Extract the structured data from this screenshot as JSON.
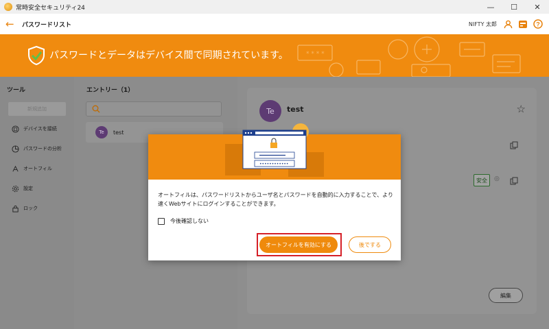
{
  "window": {
    "title": "常時安全セキュリティ24",
    "minimize": "—",
    "maximize": "☐",
    "close": "✕"
  },
  "header": {
    "title": "パスワードリスト",
    "user": "NIFTY 太郎"
  },
  "banner": {
    "text": "パスワードとデータはデバイス間で同期されています。"
  },
  "sidebar": {
    "heading": "ツール",
    "button_label": "新規追加",
    "items": [
      {
        "label": "デバイスを接続",
        "icon": "devices-icon"
      },
      {
        "label": "パスワードの分析",
        "icon": "analysis-icon"
      },
      {
        "label": "オートフィル",
        "icon": "autofill-icon"
      },
      {
        "label": "設定",
        "icon": "gear-icon"
      },
      {
        "label": "ロック",
        "icon": "lock-icon"
      }
    ]
  },
  "entries": {
    "title": "エントリー（1）",
    "items": [
      {
        "avatar": "Te",
        "name": "test"
      }
    ]
  },
  "detail": {
    "avatar": "Te",
    "name": "test",
    "safe_badge": "安全",
    "edit_label": "編集"
  },
  "modal": {
    "message": "オートフィルは、パスワードリストからユーザ名とパスワードを自動的に入力することで、より速くWebサイトにログインすることができます。",
    "checkbox_label": "今後確認しない",
    "primary_label": "オートフィルを有効にする",
    "secondary_label": "後でする"
  },
  "colors": {
    "accent": "#f08b0f",
    "highlight": "#d51f27"
  }
}
